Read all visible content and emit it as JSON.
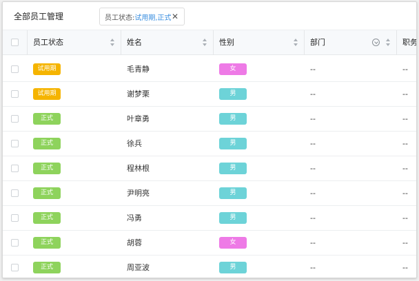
{
  "page_title": "全部员工管理",
  "filter": {
    "key": "员工状态:",
    "value": "试用期,正式",
    "close_glyph": "✕"
  },
  "columns": [
    "员工状态",
    "姓名",
    "性别",
    "部门",
    "职务"
  ],
  "colors": {
    "trial": "#f5b400",
    "formal": "#8ed35c",
    "female": "#ee7ae6",
    "male": "#6dd3d8"
  },
  "rows": [
    {
      "status": "试用期",
      "status_type": "trial",
      "name": "毛青静",
      "gender": "女",
      "gender_type": "female",
      "dept": "--",
      "title": "--"
    },
    {
      "status": "试用期",
      "status_type": "trial",
      "name": "谢梦栗",
      "gender": "男",
      "gender_type": "male",
      "dept": "--",
      "title": "--"
    },
    {
      "status": "正式",
      "status_type": "formal",
      "name": "叶章勇",
      "gender": "男",
      "gender_type": "male",
      "dept": "--",
      "title": "--"
    },
    {
      "status": "正式",
      "status_type": "formal",
      "name": "徐兵",
      "gender": "男",
      "gender_type": "male",
      "dept": "--",
      "title": "--"
    },
    {
      "status": "正式",
      "status_type": "formal",
      "name": "程林根",
      "gender": "男",
      "gender_type": "male",
      "dept": "--",
      "title": "--"
    },
    {
      "status": "正式",
      "status_type": "formal",
      "name": "尹明亮",
      "gender": "男",
      "gender_type": "male",
      "dept": "--",
      "title": "--"
    },
    {
      "status": "正式",
      "status_type": "formal",
      "name": "冯勇",
      "gender": "男",
      "gender_type": "male",
      "dept": "--",
      "title": "--"
    },
    {
      "status": "正式",
      "status_type": "formal",
      "name": "胡蓉",
      "gender": "女",
      "gender_type": "female",
      "dept": "--",
      "title": "--"
    },
    {
      "status": "正式",
      "status_type": "formal",
      "name": "周亚波",
      "gender": "男",
      "gender_type": "male",
      "dept": "--",
      "title": "--"
    }
  ]
}
